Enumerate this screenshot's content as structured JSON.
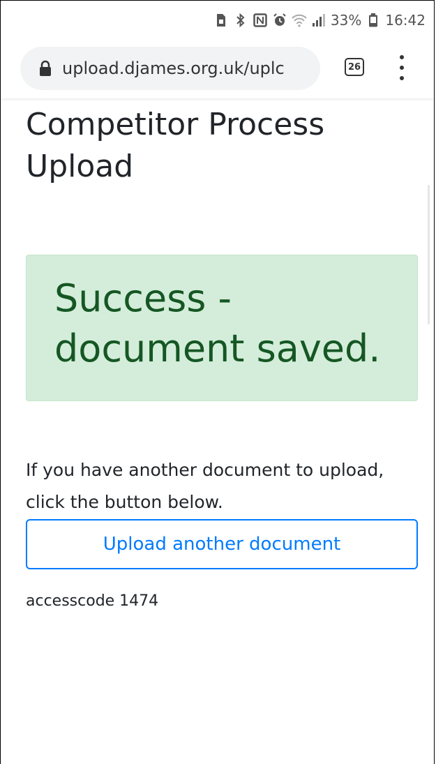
{
  "status_bar": {
    "battery_percent": "33%",
    "time": "16:42",
    "icons": [
      "sim-lock-icon",
      "bluetooth-icon",
      "nfc-icon",
      "alarm-icon",
      "wifi-icon",
      "signal-icon",
      "battery-icon"
    ]
  },
  "browser": {
    "url": "upload.djames.org.uk/uplc",
    "tab_count": "26",
    "icons": [
      "lock-icon",
      "tabs-icon",
      "menu-icon"
    ]
  },
  "page": {
    "title": "Competitor Process Upload",
    "alert": {
      "message": "Success - document saved.",
      "background": "#d4edda",
      "text_color": "#155724"
    },
    "instructions": "If you have another document to upload, click the button below.",
    "upload_button_label": "Upload another document",
    "access_code_text": "accesscode 1474",
    "accent_color": "#007bff"
  }
}
